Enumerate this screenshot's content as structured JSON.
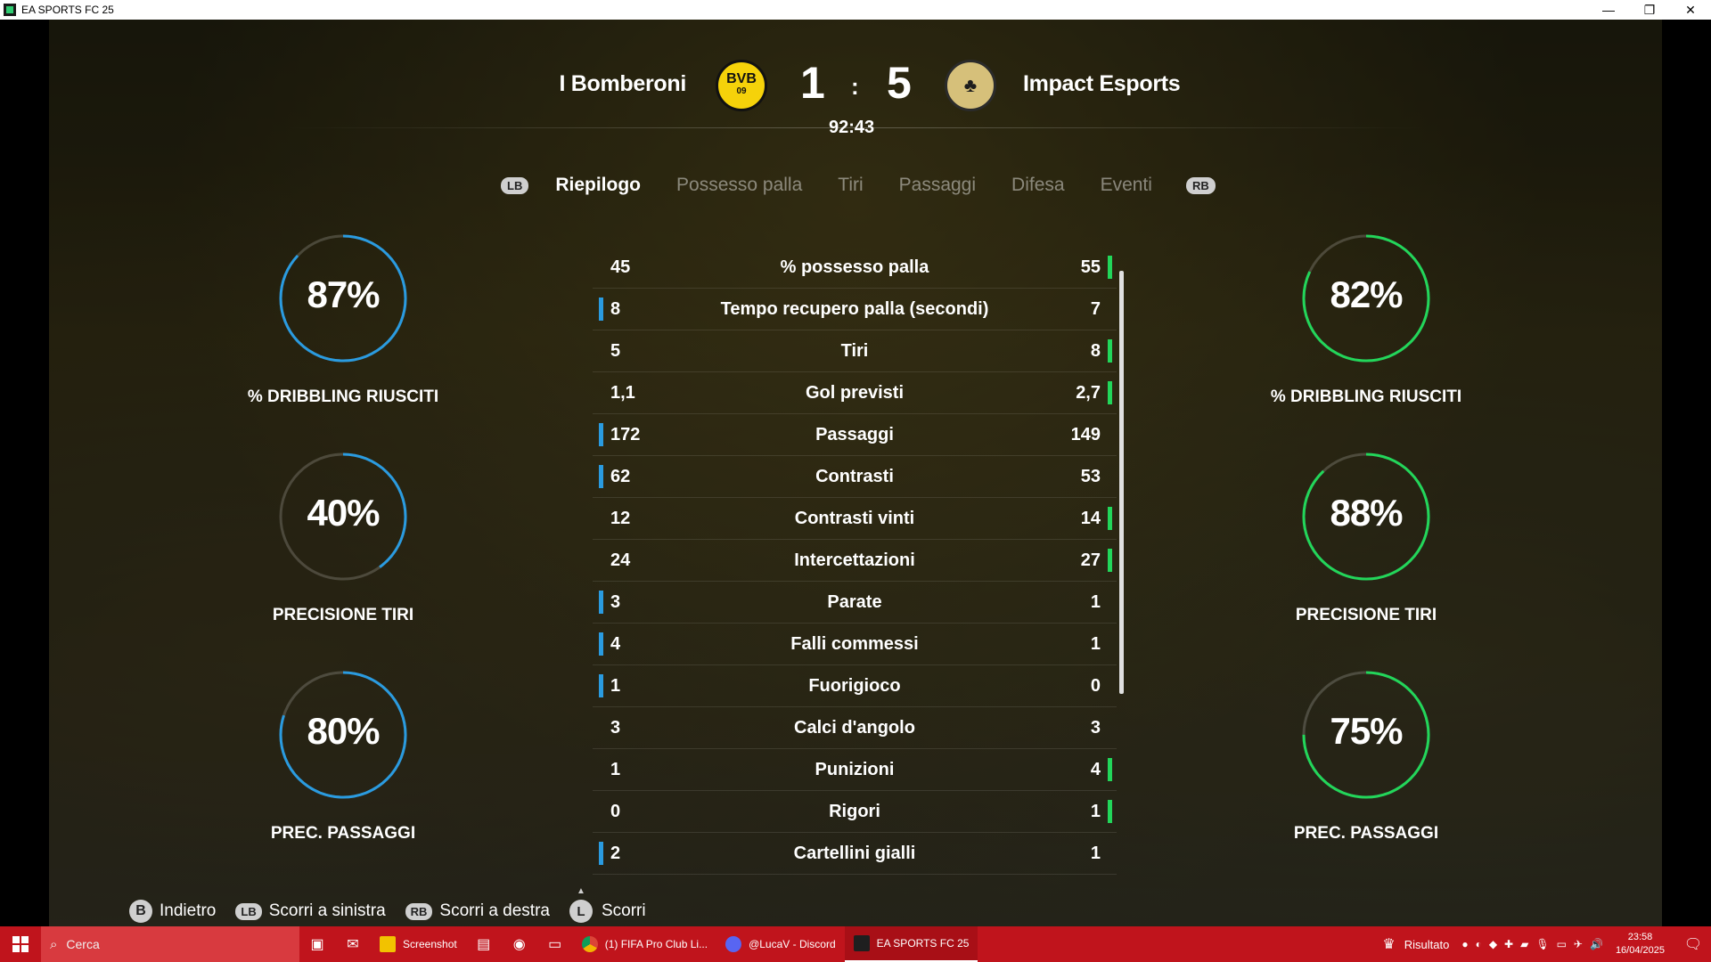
{
  "window": {
    "title": "EA SPORTS FC 25",
    "controls": [
      "—",
      "❐",
      "✕"
    ]
  },
  "match": {
    "home_team": "I Bomberoni",
    "away_team": "Impact Esports",
    "home_score": "1",
    "away_score": "5",
    "separator": ":",
    "time": "92:43",
    "home_crest_text": "BVB",
    "home_crest_sub": "09",
    "away_crest_text": "♣"
  },
  "tabs": {
    "left_button": "LB",
    "right_button": "RB",
    "items": [
      "Riepilogo",
      "Possesso palla",
      "Tiri",
      "Passaggi",
      "Difesa",
      "Eventi"
    ],
    "active": "Riepilogo"
  },
  "stats": [
    {
      "label": "% possesso palla",
      "home": "45",
      "away": "55",
      "leader": "away"
    },
    {
      "label": "Tempo recupero palla (secondi)",
      "home": "8",
      "away": "7",
      "leader": "home"
    },
    {
      "label": "Tiri",
      "home": "5",
      "away": "8",
      "leader": "away"
    },
    {
      "label": "Gol previsti",
      "home": "1,1",
      "away": "2,7",
      "leader": "away"
    },
    {
      "label": "Passaggi",
      "home": "172",
      "away": "149",
      "leader": "home"
    },
    {
      "label": "Contrasti",
      "home": "62",
      "away": "53",
      "leader": "home"
    },
    {
      "label": "Contrasti vinti",
      "home": "12",
      "away": "14",
      "leader": "away"
    },
    {
      "label": "Intercettazioni",
      "home": "24",
      "away": "27",
      "leader": "away"
    },
    {
      "label": "Parate",
      "home": "3",
      "away": "1",
      "leader": "home"
    },
    {
      "label": "Falli commessi",
      "home": "4",
      "away": "1",
      "leader": "home"
    },
    {
      "label": "Fuorigioco",
      "home": "1",
      "away": "0",
      "leader": "home"
    },
    {
      "label": "Calci d'angolo",
      "home": "3",
      "away": "3",
      "leader": "none"
    },
    {
      "label": "Punizioni",
      "home": "1",
      "away": "4",
      "leader": "away"
    },
    {
      "label": "Rigori",
      "home": "0",
      "away": "1",
      "leader": "away"
    },
    {
      "label": "Cartellini gialli",
      "home": "2",
      "away": "1",
      "leader": "home"
    }
  ],
  "rings": {
    "home": [
      {
        "pct": "87%",
        "value": 0.87,
        "label": "% DRIBBLING RIUSCITI"
      },
      {
        "pct": "40%",
        "value": 0.4,
        "label": "PRECISIONE TIRI"
      },
      {
        "pct": "80%",
        "value": 0.8,
        "label": "PREC. PASSAGGI"
      }
    ],
    "away": [
      {
        "pct": "82%",
        "value": 0.82,
        "label": "% DRIBBLING RIUSCITI"
      },
      {
        "pct": "88%",
        "value": 0.88,
        "label": "PRECISIONE TIRI"
      },
      {
        "pct": "75%",
        "value": 0.75,
        "label": "PREC. PASSAGGI"
      }
    ]
  },
  "colors": {
    "home": "#2a9be0",
    "away": "#22d65a",
    "track": "rgba(255,255,255,0.18)",
    "taskbar": "#c0141c"
  },
  "hints": [
    {
      "button": "B",
      "label": "Indietro"
    },
    {
      "button": "LB",
      "label": "Scorri a sinistra"
    },
    {
      "button": "RB",
      "label": "Scorri a destra"
    },
    {
      "button": "L",
      "label": "Scorri"
    }
  ],
  "taskbar": {
    "search_placeholder": "Cerca",
    "apps": [
      {
        "label": "Screenshot",
        "icon": "folder-icon",
        "color": "#f2c200"
      },
      {
        "label": "(1) FIFA Pro Club Li...",
        "icon": "chrome-icon",
        "color": "#e8e8e8"
      },
      {
        "label": "@LucaV - Discord",
        "icon": "discord-icon",
        "color": "#5865f2"
      },
      {
        "label": "EA SPORTS FC 25",
        "icon": "fc25-icon",
        "color": "#1f1f1f"
      }
    ],
    "status_label": "Risultato",
    "time": "23:58",
    "date": "16/04/2025"
  }
}
